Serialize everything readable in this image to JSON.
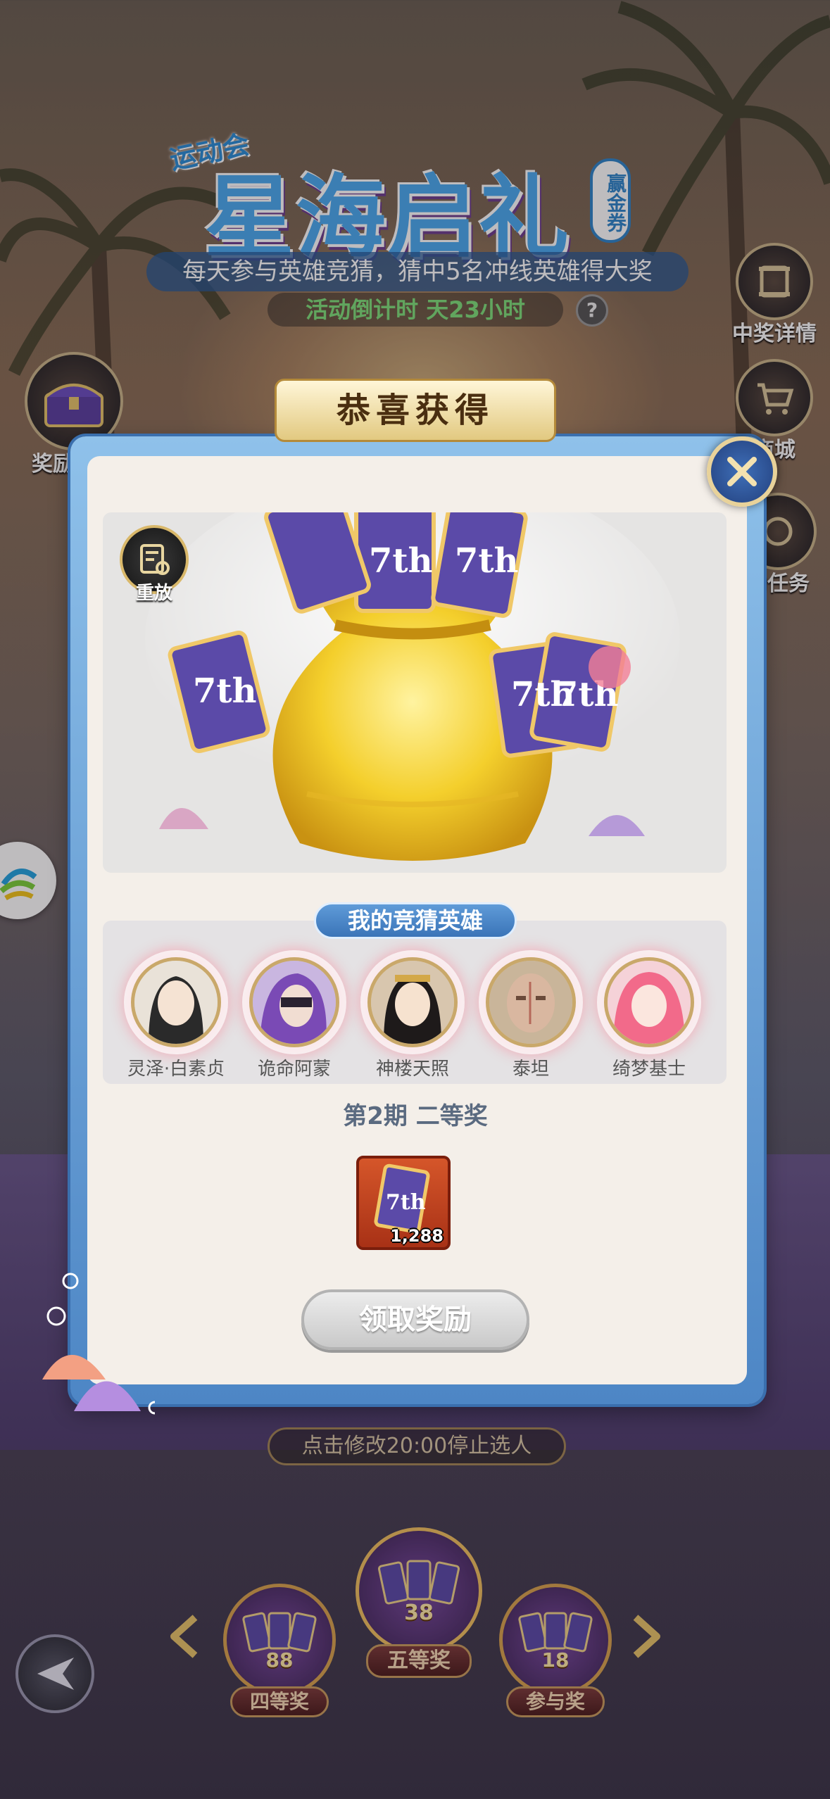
{
  "header": {
    "event_tag": "运动会",
    "title": "星海启礼",
    "badge": "赢金券",
    "subtitle": "每天参与英雄竞猜，猜中5名冲线英雄得大奖",
    "countdown": "活动倒计时 天23小时"
  },
  "side_buttons": {
    "rewards": "奖励领取",
    "prize_details": "中奖详情",
    "shop": "商城",
    "tasks": "动任务"
  },
  "modal": {
    "congrats": "恭喜获得",
    "congrats_tier": "二等奖",
    "replay_label": "重放",
    "heroes_header": "我的竞猜英雄",
    "heroes": [
      {
        "name": "灵泽·白素贞"
      },
      {
        "name": "诡命阿蒙"
      },
      {
        "name": "神楼天照"
      },
      {
        "name": "泰坦"
      },
      {
        "name": "绮梦基士"
      }
    ],
    "period_label": "第2期 二等奖",
    "reward_item": {
      "icon": "7th-ticket-icon",
      "count": "1,288"
    },
    "claim_button": "领取奖励"
  },
  "footer": {
    "modify_hint": "点击修改20:00停止选人",
    "tiers": [
      {
        "label": "四等奖",
        "count": "88"
      },
      {
        "label": "五等奖",
        "count": "38"
      },
      {
        "label": "参与奖",
        "count": "18"
      }
    ]
  },
  "colors": {
    "modal_border": "#4d86c5",
    "modal_bg": "#f4efe9",
    "accent_blue": "#3a74b8",
    "gold": "#d9a24e",
    "ticket_purple": "#5b4aa8"
  }
}
